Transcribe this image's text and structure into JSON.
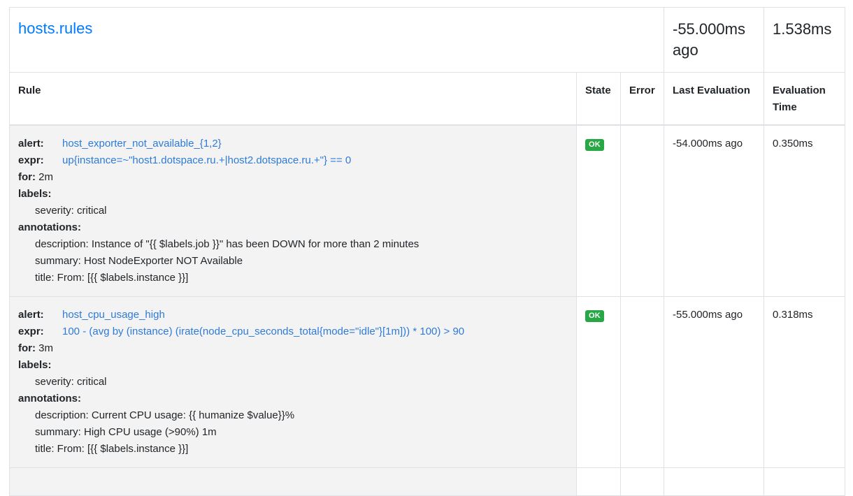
{
  "group": {
    "name": "hosts.rules",
    "last_evaluation": "-55.000ms ago",
    "evaluation_time": "1.538ms"
  },
  "columns": {
    "rule": "Rule",
    "state": "State",
    "error": "Error",
    "last_evaluation": "Last Evaluation",
    "evaluation_time": "Evaluation Time"
  },
  "labels": {
    "alert": "alert:",
    "expr": "expr:",
    "for": "for:",
    "labels": "labels:",
    "annotations": "annotations:"
  },
  "rules": [
    {
      "alert": "host_exporter_not_available_{1,2}",
      "expr": "up{instance=~\"host1.dotspace.ru.+|host2.dotspace.ru.+\"} == 0",
      "for": "2m",
      "severity": "severity: critical",
      "description": "description: Instance of \"{{ $labels.job }}\" has been DOWN for more than 2 minutes",
      "summary": "summary: Host NodeExporter NOT Available",
      "title": "title: From: [{{ $labels.instance }}]",
      "state": "OK",
      "error": "",
      "last_evaluation": "-54.000ms ago",
      "evaluation_time": "0.350ms"
    },
    {
      "alert": "host_cpu_usage_high",
      "expr": "100 - (avg by (instance) (irate(node_cpu_seconds_total{mode=\"idle\"}[1m])) * 100) > 90",
      "for": "3m",
      "severity": "severity: critical",
      "description": "description: Current CPU usage: {{ humanize $value}}%",
      "summary": "summary: High CPU usage (>90%) 1m",
      "title": "title: From: [{{ $labels.instance }}]",
      "state": "OK",
      "error": "",
      "last_evaluation": "-55.000ms ago",
      "evaluation_time": "0.318ms"
    }
  ],
  "colors": {
    "link": "#007bff",
    "ok_badge": "#28a745",
    "rule_bg": "#f3f3f3",
    "border": "#dee2e6"
  }
}
